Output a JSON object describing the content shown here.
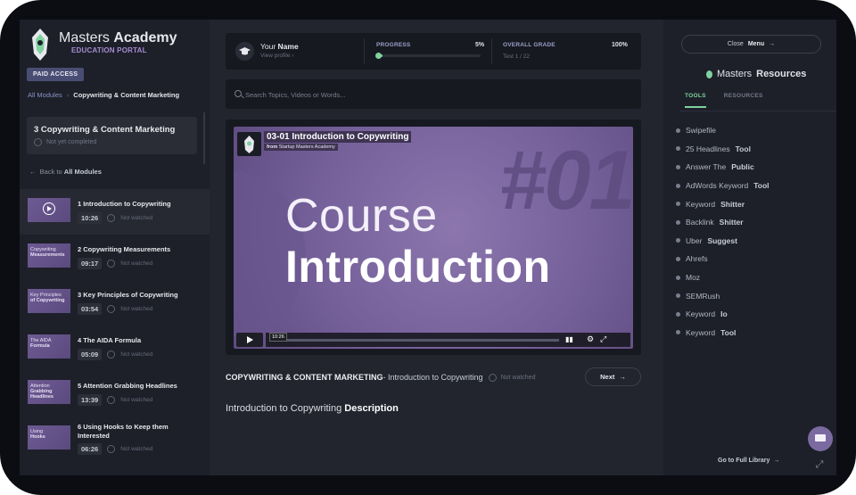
{
  "brand": {
    "title_light": "Masters ",
    "title_bold": "Academy",
    "subtitle": "EDUCATION PORTAL"
  },
  "badge": "PAID ACCESS",
  "breadcrumb": {
    "root": "All Modules",
    "current": "Copywriting & Content Marketing"
  },
  "module": {
    "title": "3  Copywriting & Content Marketing",
    "status": "Not yet completed"
  },
  "back": {
    "prefix": "Back to ",
    "label": "All Modules"
  },
  "lessons": [
    {
      "title": "1  Introduction to Copywriting",
      "duration": "10:26",
      "status": "Not watched",
      "thumb_light": "",
      "thumb_bold": ""
    },
    {
      "title": "2  Copywriting Measurements",
      "duration": "09:17",
      "status": "Not watched",
      "thumb_light": "Copywriting",
      "thumb_bold": "Measurements"
    },
    {
      "title": "3  Key Principles of Copywriting",
      "duration": "03:54",
      "status": "Not watched",
      "thumb_light": "Key Principles",
      "thumb_bold": "of Copywriting"
    },
    {
      "title": "4  The AIDA Formula",
      "duration": "05:09",
      "status": "Not watched",
      "thumb_light": "The AIDA",
      "thumb_bold": "Formula"
    },
    {
      "title": "5  Attention Grabbing Headlines",
      "duration": "13:39",
      "status": "Not watched",
      "thumb_light": "Attention",
      "thumb_bold": "Grabbing Headlines"
    },
    {
      "title": "6  Using Hooks to Keep them Interested",
      "duration": "06:26",
      "status": "Not watched",
      "thumb_light": "Using",
      "thumb_bold": "Hooks"
    }
  ],
  "profile": {
    "name_light": "Your ",
    "name_bold": "Name",
    "view": "View profile  ›"
  },
  "progress": {
    "label": "PROGRESS",
    "value": "5%",
    "fraction": 0.05
  },
  "grade": {
    "label": "OVERALL GRADE",
    "value": "100%",
    "sub": "Test 1 / 22"
  },
  "search": {
    "placeholder": "Search Topics, Videos or Words..."
  },
  "video": {
    "title": "03-01 Introduction to Copywriting",
    "from_prefix": "from ",
    "from_bold": "Startup Masters Academy",
    "big_number": "#01",
    "line1": "Course",
    "line2": "Introduction",
    "time": "10:26"
  },
  "course_line": {
    "module": "COPYWRITING & CONTENT MARKETING",
    "lesson": " - Introduction to Copywriting",
    "status": "Not watched"
  },
  "next_label": "Next",
  "description": {
    "light": "Introduction to Copywriting ",
    "bold": "Description"
  },
  "right": {
    "close_prefix": "Close ",
    "close_bold": "Menu",
    "res_light": "Masters ",
    "res_bold": "Resources",
    "tabs": [
      "TOOLS",
      "RESOURCES"
    ],
    "tools": [
      {
        "light": "Swipefile",
        "bold": ""
      },
      {
        "light": "25 Headlines ",
        "bold": "Tool"
      },
      {
        "light": "Answer The ",
        "bold": "Public"
      },
      {
        "light": "AdWords Keyword ",
        "bold": "Tool"
      },
      {
        "light": "Keyword ",
        "bold": "Shitter"
      },
      {
        "light": "Backlink ",
        "bold": "Shitter"
      },
      {
        "light": "Uber ",
        "bold": "Suggest"
      },
      {
        "light": "Ahrefs",
        "bold": ""
      },
      {
        "light": "Moz",
        "bold": ""
      },
      {
        "light": "SEMRush",
        "bold": ""
      },
      {
        "light": "Keyword ",
        "bold": "Io"
      },
      {
        "light": "Keyword ",
        "bold": "Tool"
      }
    ],
    "full_library": "Go to Full Library"
  },
  "colors": {
    "accent": "#7fd2a0",
    "purple": "#75609a",
    "panel": "#1d2029",
    "badge": "#4a4d73"
  }
}
